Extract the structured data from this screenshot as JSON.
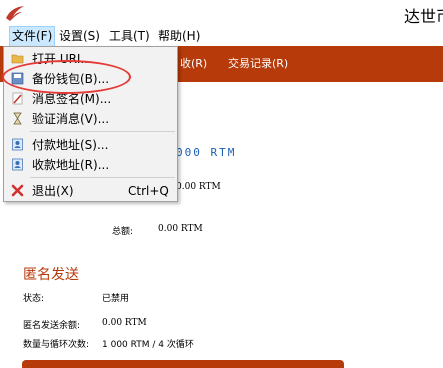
{
  "window": {
    "title": "达世币"
  },
  "menubar": {
    "file": "文件(F)",
    "settings": "设置(S)",
    "tools": "工具(T)",
    "help": "帮助(H)"
  },
  "nav": {
    "partial_tab": "收(R)",
    "transactions_tab": "交易记录(R)"
  },
  "file_menu": {
    "items": [
      {
        "label": "打开 URI...",
        "icon": "folder-icon"
      },
      {
        "label": "备份钱包(B)...",
        "icon": "backup-icon"
      },
      {
        "label": "消息签名(M)...",
        "icon": "pen-icon"
      },
      {
        "label": "验证消息(V)...",
        "icon": "hourglass-icon"
      },
      {
        "label": "付款地址(S)...",
        "icon": "address-book-icon"
      },
      {
        "label": "收款地址(R)...",
        "icon": "address-book-icon"
      },
      {
        "label": "退出(X)",
        "icon": "close-icon",
        "shortcut": "Ctrl+Q"
      }
    ]
  },
  "overview": {
    "balance_main": "000 RTM",
    "balance_secondary": "0.00 RTM",
    "total_label": "总额:",
    "total_value": "0.00 RTM"
  },
  "anon_send": {
    "title": "匿名发送",
    "status_label": "状态:",
    "status_value": "已禁用",
    "balance_label": "匿名发送余额:",
    "balance_value": "0.00 RTM",
    "rounds_label": "数量与循环次数:",
    "rounds_value": "1 000 RTM / 4 次循环"
  }
}
